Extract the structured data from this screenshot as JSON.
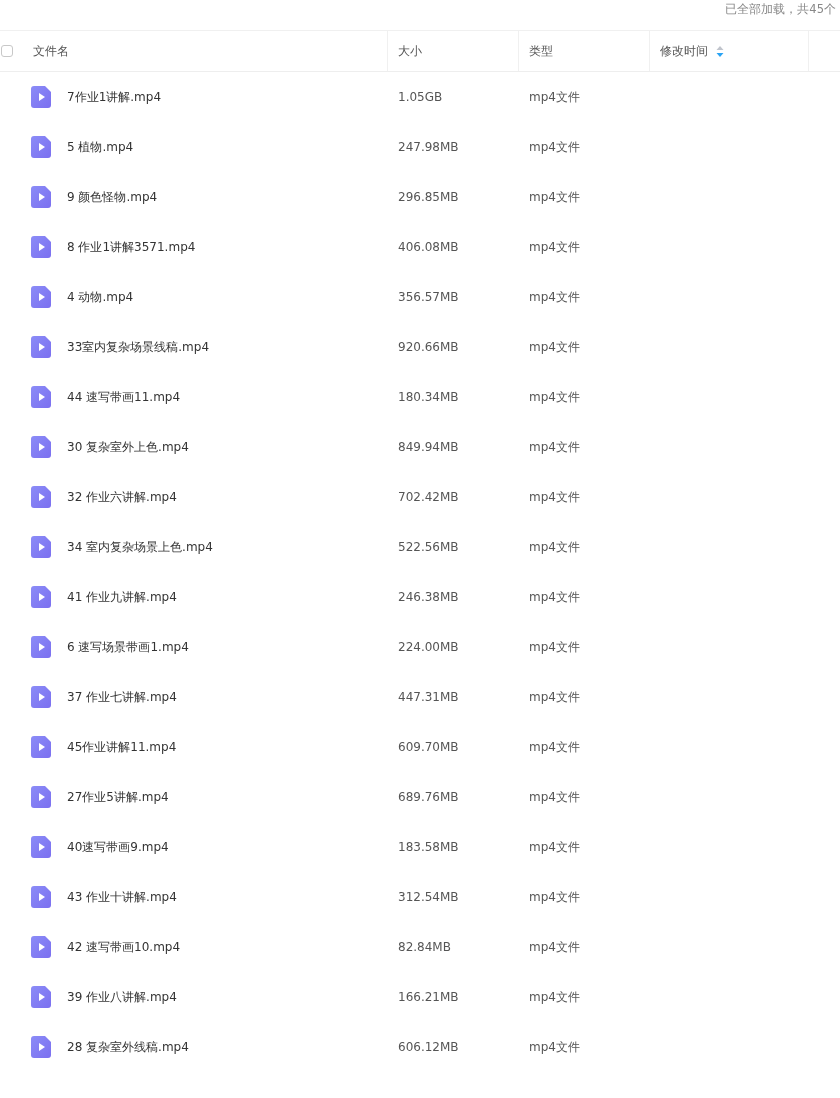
{
  "status": "已全部加载，共45个",
  "header": {
    "select_all": {
      "checked": false
    },
    "columns": [
      {
        "label": "文件名",
        "sortable": false
      },
      {
        "label": "大小",
        "sortable": false
      },
      {
        "label": "类型",
        "sortable": false
      },
      {
        "label": "修改时间",
        "sortable": true
      }
    ]
  },
  "rows": [
    {
      "name": "7作业1讲解.mp4",
      "size": "1.05GB",
      "type": "mp4文件"
    },
    {
      "name": "5 植物.mp4",
      "size": "247.98MB",
      "type": "mp4文件"
    },
    {
      "name": "9 颜色怪物.mp4",
      "size": "296.85MB",
      "type": "mp4文件"
    },
    {
      "name": "8 作业1讲解3571.mp4",
      "size": "406.08MB",
      "type": "mp4文件"
    },
    {
      "name": "4 动物.mp4",
      "size": "356.57MB",
      "type": "mp4文件"
    },
    {
      "name": "33室内复杂场景线稿.mp4",
      "size": "920.66MB",
      "type": "mp4文件"
    },
    {
      "name": "44 速写带画11.mp4",
      "size": "180.34MB",
      "type": "mp4文件"
    },
    {
      "name": "30 复杂室外上色.mp4",
      "size": "849.94MB",
      "type": "mp4文件"
    },
    {
      "name": "32 作业六讲解.mp4",
      "size": "702.42MB",
      "type": "mp4文件"
    },
    {
      "name": "34 室内复杂场景上色.mp4",
      "size": "522.56MB",
      "type": "mp4文件"
    },
    {
      "name": "41 作业九讲解.mp4",
      "size": "246.38MB",
      "type": "mp4文件"
    },
    {
      "name": "6 速写场景带画1.mp4",
      "size": "224.00MB",
      "type": "mp4文件"
    },
    {
      "name": "37 作业七讲解.mp4",
      "size": "447.31MB",
      "type": "mp4文件"
    },
    {
      "name": "45作业讲解11.mp4",
      "size": "609.70MB",
      "type": "mp4文件"
    },
    {
      "name": "27作业5讲解.mp4",
      "size": "689.76MB",
      "type": "mp4文件"
    },
    {
      "name": "40速写带画9.mp4",
      "size": "183.58MB",
      "type": "mp4文件"
    },
    {
      "name": "43 作业十讲解.mp4",
      "size": "312.54MB",
      "type": "mp4文件"
    },
    {
      "name": "42 速写带画10.mp4",
      "size": "82.84MB",
      "type": "mp4文件"
    },
    {
      "name": "39 作业八讲解.mp4",
      "size": "166.21MB",
      "type": "mp4文件"
    },
    {
      "name": "28 复杂室外线稿.mp4",
      "size": "606.12MB",
      "type": "mp4文件"
    }
  ]
}
